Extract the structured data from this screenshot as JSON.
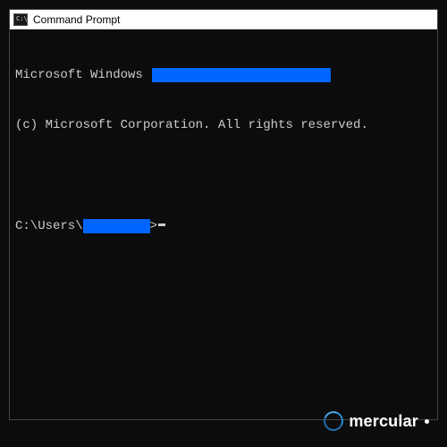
{
  "window": {
    "title": "Command Prompt"
  },
  "terminal": {
    "line1_prefix": "Microsoft Windows ",
    "line2": "(c) Microsoft Corporation. All rights reserved.",
    "prompt_prefix": "C:\\Users\\",
    "prompt_suffix": ">"
  },
  "colors": {
    "terminal_bg": "#0c0c0c",
    "terminal_fg": "#cccccc",
    "redaction": "#0066ff",
    "titlebar_bg": "#ffffff"
  },
  "watermark": {
    "text": "mercular"
  }
}
